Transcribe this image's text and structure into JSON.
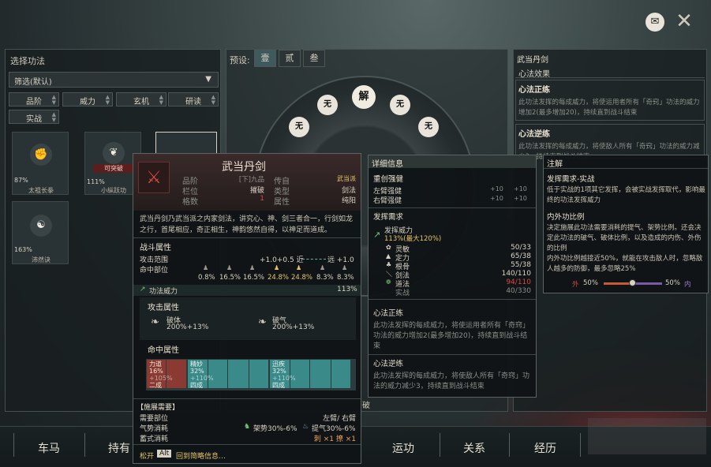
{
  "left_panel": {
    "title": "选择功法",
    "filter": "筛选(默认)",
    "sort_buttons": [
      "品阶",
      "威力",
      "玄机",
      "研读",
      "实战"
    ],
    "cards": [
      {
        "pct": "87%",
        "name": "太祖长拳",
        "badge": ""
      },
      {
        "pct": "111%",
        "name": "小纵跃功",
        "badge": "可突破"
      },
      {
        "pct": "163%",
        "name": "沛然诀",
        "badge": ""
      }
    ]
  },
  "preset": {
    "label": "预设:",
    "tabs": [
      "壹",
      "贰",
      "叁"
    ]
  },
  "wheel": {
    "slots": [
      "无",
      "解",
      "无",
      "无",
      "无"
    ]
  },
  "right_panel": {
    "title": "武当丹剑",
    "effect": "心法效果",
    "zheng": "心法正练",
    "zheng_text": "此功法发挥的每成威力，将使运用者所有「奇窍」功法的威力增加2(最多增加20)，持续直到战斗结束",
    "ni": "心法逆练",
    "ni_text": "此功法发挥的每成威力，将使敌人所有「奇窍」功法的威力减少3，持续直到战斗结束"
  },
  "tooltip": {
    "name": "武当丹剑",
    "rows": [
      [
        "品阶",
        "[下]九品",
        "传自",
        "武当派"
      ],
      [
        "栏位",
        "摧破",
        "类型",
        "剑法"
      ],
      [
        "格数",
        "1",
        "属性",
        "纯阳"
      ]
    ],
    "desc": "武当丹剑乃武当派之内家剑法，讲究心、神、剑三者合一，行剑如龙之行，首尾相应，奇正相生，神韵悠然自得，以神足而道成。",
    "battle": "战斗属性",
    "range_label": "攻击范围",
    "range_val": "+1.0+0.5 近",
    "range_far": "远 +1.0",
    "hit_label": "命中部位",
    "hit_vals": [
      "0.8%",
      "16.5%",
      "16.5%",
      "24.8%",
      "24.8%",
      "8.3%",
      "8.3%"
    ],
    "power_label": "功法威力",
    "power_val": "113%",
    "atk_label": "攻击属性",
    "atk": [
      {
        "name": "破体",
        "val": "200%+13%"
      },
      {
        "name": "破气",
        "val": "200%+13%"
      }
    ],
    "hitattr_label": "命中属性",
    "bar_segs": [
      {
        "name": "力道",
        "v": "16%",
        "s": "+105%",
        "c": "二成"
      },
      {
        "name": "精妙",
        "v": "32%",
        "s": "+110%",
        "c": "四成"
      },
      {
        "name": "",
        "v": "",
        "s": "",
        "c": ""
      },
      {
        "name": "",
        "v": "",
        "s": "",
        "c": ""
      },
      {
        "name": "迅疾",
        "v": "32%",
        "s": "+110%",
        "c": "四成"
      }
    ],
    "cast_label": "【施展需要】",
    "need_part": "需要部位",
    "need_part_val": "左臂/ 右臂",
    "qi_label": "气势消耗",
    "qi_a": "架势30%-6%",
    "qi_b": "提气30%-6%",
    "trick_label": "蓄式消耗",
    "trick_val": "刺 ×1 撩 ×1",
    "footer_a": "松开",
    "footer_key": "Alt",
    "footer_b": "回到简略信息…"
  },
  "detail": {
    "title": "详细信息",
    "zhong": "重创强健",
    "left": "左臂强健",
    "right": "右臂强健",
    "plus": "+10",
    "req_title": "发挥需求",
    "power": "发挥威力",
    "power_v": "113%(最大120%)",
    "stats": [
      [
        "灵敏",
        "50/33"
      ],
      [
        "定力",
        "65/38"
      ],
      [
        "根骨",
        "55/38"
      ],
      [
        "剑法",
        "140/110"
      ],
      [
        "道法",
        "94/110"
      ],
      [
        "实战",
        "40/330"
      ]
    ],
    "zheng": "心法正练",
    "zheng_text": "此功法发挥的每成威力，将使运用者所有「奇窍」功法的威力增加2(最多增加20)，持续直到战斗结束",
    "ni": "心法逆练",
    "ni_text": "此功法发挥的每成威力，将使敌人所有「奇窍」功法的威力减少3，持续直到战斗结束"
  },
  "note": {
    "title": "注解",
    "h1": "发挥需求-实战",
    "t1": "低于实战的1项其它发挥，会被实战发挥取代，影响最终的功法发挥威力",
    "h2": "内外功比例",
    "t2": "决定施展此功法需要消耗的提气、架势比例。还会决定此功法的破气、破体比例，以及造成的内伤、外伤的比例\n内外功比例越接近50%，就能在攻击敌人时，忽略敌人越多的防御，最多忽略25%",
    "wai": "外",
    "wai_v": "50%",
    "nei_v": "50%",
    "nei": "内"
  },
  "nav": [
    "车马",
    "持有",
    "运功",
    "关系",
    "经历"
  ],
  "misc": {
    "xia": "破"
  }
}
